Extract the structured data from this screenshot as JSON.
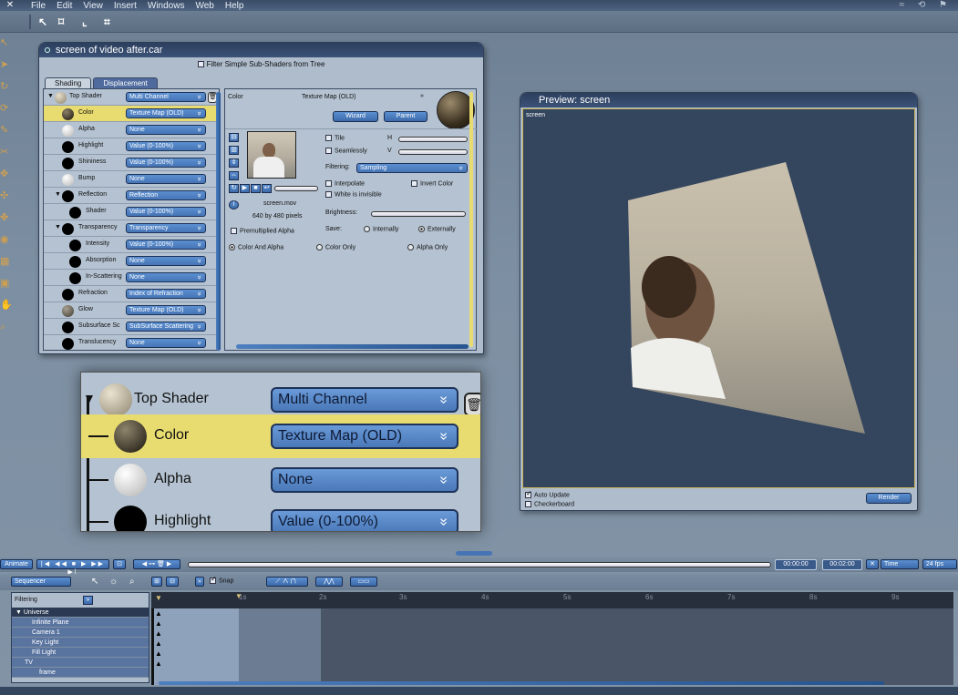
{
  "menu": {
    "items": [
      "File",
      "Edit",
      "View",
      "Insert",
      "Windows",
      "Web",
      "Help"
    ]
  },
  "shader_window": {
    "title": "screen of video  after.car",
    "filter_label": "Filter Simple Sub-Shaders from Tree",
    "tabs": [
      "Shading",
      "Displacement"
    ],
    "tree": [
      {
        "label": "Top Shader",
        "value": "Multi Channel"
      },
      {
        "label": "Color",
        "value": "Texture Map (OLD)"
      },
      {
        "label": "Alpha",
        "value": "None"
      },
      {
        "label": "Highlight",
        "value": "Value (0-100%)"
      },
      {
        "label": "Shininess",
        "value": "Value (0-100%)"
      },
      {
        "label": "Bump",
        "value": "None"
      },
      {
        "label": "Reflection",
        "value": "Reflection"
      },
      {
        "label": "Shader",
        "value": "Value (0-100%)"
      },
      {
        "label": "Transparency",
        "value": "Transparency"
      },
      {
        "label": "Intensity",
        "value": "Value (0-100%)"
      },
      {
        "label": "Absorption",
        "value": "None"
      },
      {
        "label": "In-Scattering",
        "value": "None"
      },
      {
        "label": "Refraction",
        "value": "Index of Refraction"
      },
      {
        "label": "Glow",
        "value": "Texture Map (OLD)"
      },
      {
        "label": "Subsurface Sc",
        "value": "SubSurface Scattering"
      },
      {
        "label": "Translucency",
        "value": "None"
      }
    ],
    "detail": {
      "channel": "Color",
      "type": "Texture Map (OLD)",
      "wizard": "Wizard",
      "parent": "Parent",
      "tile": "Tile",
      "h": "H",
      "seamlessly": "Seamlessly",
      "v": "V",
      "filtering_label": "Filtering:",
      "filtering_value": "Sampling",
      "interpolate": "Interpolate",
      "invert_color": "Invert Color",
      "white_invisible": "White is invisible",
      "brightness": "Brightness:",
      "save": "Save:",
      "internally": "Internally",
      "externally": "Externally",
      "file_name": "screen.mov",
      "file_size": "640 by 480 pixels",
      "premult": "Premultiplied Alpha",
      "color_and_alpha": "Color And Alpha",
      "color_only": "Color Only",
      "alpha_only": "Alpha Only"
    }
  },
  "zoom": {
    "rows": [
      {
        "label": "Top Shader",
        "value": "Multi Channel"
      },
      {
        "label": "Color",
        "value": "Texture Map (OLD)"
      },
      {
        "label": "Alpha",
        "value": "None"
      },
      {
        "label": "Highlight",
        "value": "Value (0-100%)"
      }
    ]
  },
  "preview": {
    "title": "Preview: screen",
    "view_label": "screen",
    "auto_update": "Auto Update",
    "checkerboard": "Checkerboard",
    "render": "Render"
  },
  "animate": {
    "label": "Animate",
    "time_current": "00:00:00",
    "time_total": "00:02:00",
    "time_mode": "Time",
    "fps": "24 fps"
  },
  "sequencer": {
    "mode": "Sequencer",
    "snap": "Snap",
    "filtering": "Filtering",
    "rows": [
      "Universe",
      "Infinite Plane",
      "Camera 1",
      "Key Light",
      "Fill Light",
      "TV",
      "frame"
    ],
    "ticks": [
      "1s",
      "2s",
      "3s",
      "4s",
      "5s",
      "6s",
      "7s",
      "8s",
      "9s"
    ]
  },
  "colors": {
    "title_bar": "#2c3f5e",
    "selection": "#e8dc70",
    "button": "#4675b5"
  }
}
